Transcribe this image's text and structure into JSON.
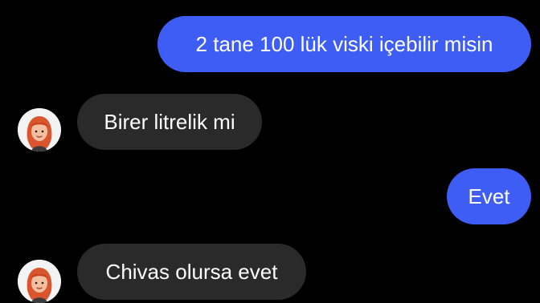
{
  "colors": {
    "background": "#000000",
    "outgoing_bubble": "#3e5df5",
    "incoming_bubble": "#2a2a2a",
    "text": "#ffffff"
  },
  "messages": [
    {
      "direction": "outgoing",
      "text": "2 tane 100 lük viski içebilir misin"
    },
    {
      "direction": "incoming",
      "text": "Birer litrelik mi",
      "avatar_icon": "memoji-avatar-icon"
    },
    {
      "direction": "outgoing",
      "text": "Evet"
    },
    {
      "direction": "incoming",
      "text": "Chivas olursa evet",
      "avatar_icon": "memoji-avatar-icon"
    }
  ]
}
